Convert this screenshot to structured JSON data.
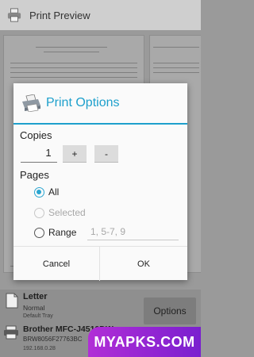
{
  "app": {
    "title": "Print Preview",
    "icon": "printer-icon"
  },
  "dialog": {
    "title": "Print Options",
    "icon": "printer-icon",
    "copies_label": "Copies",
    "copies_value": "1",
    "plus_label": "+",
    "minus_label": "-",
    "pages_label": "Pages",
    "radio_all": "All",
    "radio_selected": "Selected",
    "radio_range": "Range",
    "range_placeholder": "1, 5-7, 9",
    "selected_option": "All",
    "cancel_label": "Cancel",
    "ok_label": "OK",
    "accent_color": "#1ea0cc"
  },
  "paper": {
    "name": "Letter",
    "quality": "Normal",
    "tray": "Default Tray"
  },
  "printer": {
    "name": "Brother MFC-J4510DW",
    "serial": "BRW8056F27763BC",
    "ip": "192.168.0.28"
  },
  "options_label": "Options",
  "watermark": "MYAPKS.COM"
}
